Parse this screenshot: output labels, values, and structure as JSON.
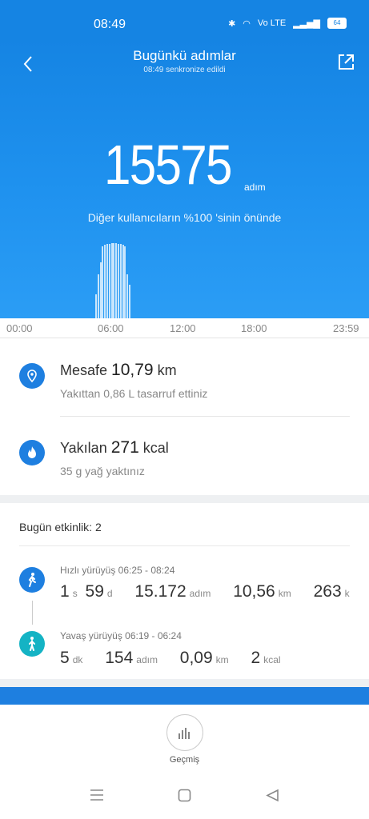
{
  "status": {
    "time": "08:49",
    "battery": "64",
    "net": "Vo LTE"
  },
  "header": {
    "title": "Bugünkü adımlar",
    "sync": "08:49 senkronize edildi"
  },
  "steps": {
    "value": "15575",
    "unit": "adım",
    "rank_text": "Diğer kullanıcıların %100 'sinin önünde"
  },
  "axis": [
    "00:00",
    "06:00",
    "12:00",
    "18:00",
    "23:59"
  ],
  "stats": {
    "distance": {
      "label": "Mesafe",
      "value": "10,79",
      "unit": "km",
      "note": "Yakıttan 0,86 L tasarruf ettiniz"
    },
    "calories": {
      "label": "Yakılan",
      "value": "271",
      "unit": "kcal",
      "note": "35 g yağ yaktınız"
    }
  },
  "activity": {
    "header": "Bugün etkinlik:",
    "count": "2",
    "items": [
      {
        "title": "Hızlı yürüyüş 06:25 - 08:24",
        "metrics": [
          [
            "1",
            "s"
          ],
          [
            "59",
            "d"
          ],
          [
            "15.172",
            "adım"
          ],
          [
            "10,56",
            "km"
          ],
          [
            "263",
            "k"
          ]
        ]
      },
      {
        "title": "Yavaş yürüyüş 06:19 - 06:24",
        "metrics": [
          [
            "5",
            "dk"
          ],
          [
            "154",
            "adım"
          ],
          [
            "0,09",
            "km"
          ],
          [
            "2",
            "kcal"
          ]
        ]
      }
    ]
  },
  "bottom": {
    "history_label": "Geçmiş"
  },
  "colors": {
    "primary": "#1584e3",
    "accent_teal": "#14b3c4"
  }
}
